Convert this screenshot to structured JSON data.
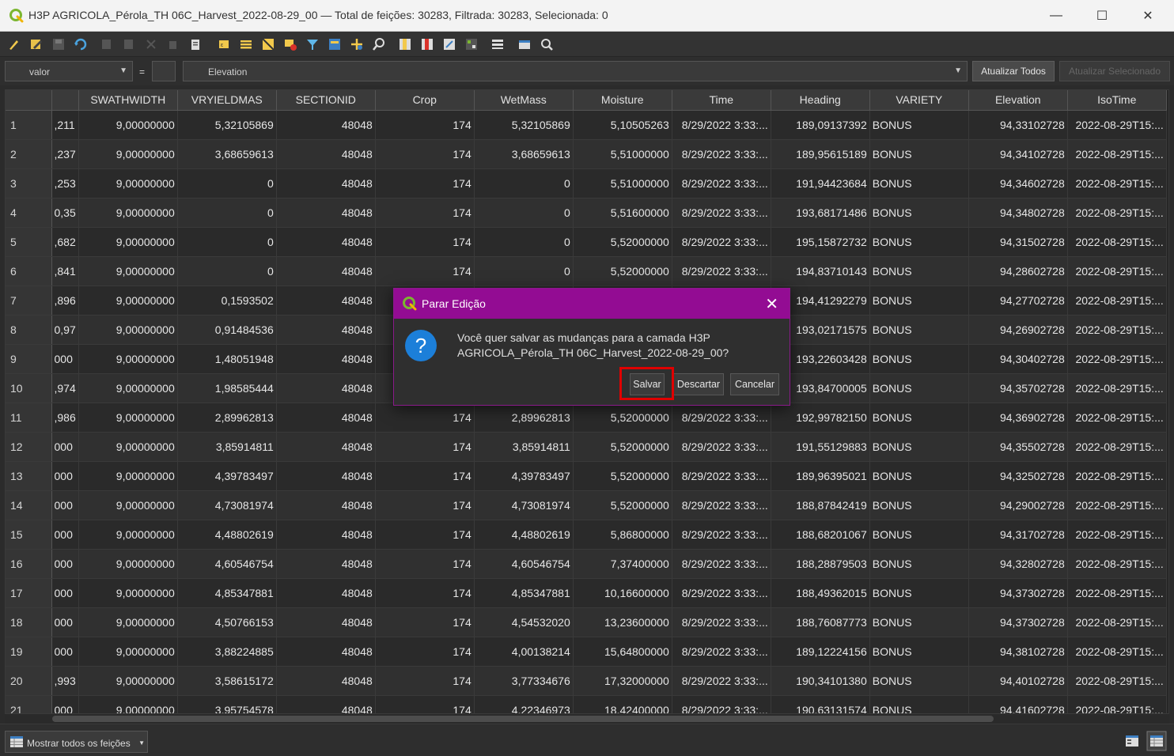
{
  "window": {
    "title": "H3P AGRICOLA_Pérola_TH 06C_Harvest_2022-08-29_00 — Total de feições: 30283, Filtrada: 30283, Selecionada: 0",
    "minimize": "—",
    "maximize": "☐",
    "close": "✕"
  },
  "toolbar": {
    "icons": [
      "toggle-edit-icon",
      "multi-edit-icon",
      "save-edits-icon",
      "reload-icon",
      "add-feature-icon",
      "delete-feature-icon",
      "cut-icon",
      "copy-icon",
      "paste-icon",
      "select-expression-icon",
      "select-all-icon",
      "invert-selection-icon",
      "deselect-icon",
      "filter-icon",
      "move-top-icon",
      "pan-to-selection-icon",
      "zoom-to-selection-icon",
      "new-field-icon",
      "delete-field-icon",
      "field-calculator-icon",
      "conditional-format-icon",
      "dock-icon",
      "actions-icon",
      "zoom-icon"
    ]
  },
  "filterbar": {
    "field": "valor",
    "equals": "=",
    "expression": "Elevation",
    "update_all": "Atualizar Todos",
    "update_selected": "Atualizar Selecionado"
  },
  "table": {
    "columns": [
      "",
      "SWATHWIDTH",
      "VRYIELDMAS",
      "SECTIONID",
      "Crop",
      "WetMass",
      "Moisture",
      "Time",
      "Heading",
      "VARIETY",
      "Elevation",
      "IsoTime"
    ],
    "rows": [
      [
        "1",
        ",211",
        "9,00000000",
        "5,32105869",
        "48048",
        "174",
        "5,32105869",
        "5,10505263",
        "8/29/2022 3:33:...",
        "189,09137392",
        "BONUS",
        "94,33102728",
        "2022-08-29T15:..."
      ],
      [
        "2",
        ",237",
        "9,00000000",
        "3,68659613",
        "48048",
        "174",
        "3,68659613",
        "5,51000000",
        "8/29/2022 3:33:...",
        "189,95615189",
        "BONUS",
        "94,34102728",
        "2022-08-29T15:..."
      ],
      [
        "3",
        ",253",
        "9,00000000",
        "0",
        "48048",
        "174",
        "0",
        "5,51000000",
        "8/29/2022 3:33:...",
        "191,94423684",
        "BONUS",
        "94,34602728",
        "2022-08-29T15:..."
      ],
      [
        "4",
        "0,35",
        "9,00000000",
        "0",
        "48048",
        "174",
        "0",
        "5,51600000",
        "8/29/2022 3:33:...",
        "193,68171486",
        "BONUS",
        "94,34802728",
        "2022-08-29T15:..."
      ],
      [
        "5",
        ",682",
        "9,00000000",
        "0",
        "48048",
        "174",
        "0",
        "5,52000000",
        "8/29/2022 3:33:...",
        "195,15872732",
        "BONUS",
        "94,31502728",
        "2022-08-29T15:..."
      ],
      [
        "6",
        ",841",
        "9,00000000",
        "0",
        "48048",
        "174",
        "0",
        "5,52000000",
        "8/29/2022 3:33:...",
        "194,83710143",
        "BONUS",
        "94,28602728",
        "2022-08-29T15:..."
      ],
      [
        "7",
        ",896",
        "9,00000000",
        "0,1593502",
        "48048",
        "",
        "",
        "",
        "",
        "194,41292279",
        "BONUS",
        "94,27702728",
        "2022-08-29T15:..."
      ],
      [
        "8",
        "0,97",
        "9,00000000",
        "0,91484536",
        "48048",
        "",
        "",
        "",
        "",
        "193,02171575",
        "BONUS",
        "94,26902728",
        "2022-08-29T15:..."
      ],
      [
        "9",
        "000",
        "9,00000000",
        "1,48051948",
        "48048",
        "",
        "",
        "",
        "",
        "193,22603428",
        "BONUS",
        "94,30402728",
        "2022-08-29T15:..."
      ],
      [
        "10",
        ",974",
        "9,00000000",
        "1,98585444",
        "48048",
        "",
        "",
        "",
        "",
        "193,84700005",
        "BONUS",
        "94,35702728",
        "2022-08-29T15:..."
      ],
      [
        "11",
        ",986",
        "9,00000000",
        "2,89962813",
        "48048",
        "174",
        "2,89962813",
        "5,52000000",
        "8/29/2022 3:33:...",
        "192,99782150",
        "BONUS",
        "94,36902728",
        "2022-08-29T15:..."
      ],
      [
        "12",
        "000",
        "9,00000000",
        "3,85914811",
        "48048",
        "174",
        "3,85914811",
        "5,52000000",
        "8/29/2022 3:33:...",
        "191,55129883",
        "BONUS",
        "94,35502728",
        "2022-08-29T15:..."
      ],
      [
        "13",
        "000",
        "9,00000000",
        "4,39783497",
        "48048",
        "174",
        "4,39783497",
        "5,52000000",
        "8/29/2022 3:33:...",
        "189,96395021",
        "BONUS",
        "94,32502728",
        "2022-08-29T15:..."
      ],
      [
        "14",
        "000",
        "9,00000000",
        "4,73081974",
        "48048",
        "174",
        "4,73081974",
        "5,52000000",
        "8/29/2022 3:33:...",
        "188,87842419",
        "BONUS",
        "94,29002728",
        "2022-08-29T15:..."
      ],
      [
        "15",
        "000",
        "9,00000000",
        "4,48802619",
        "48048",
        "174",
        "4,48802619",
        "5,86800000",
        "8/29/2022 3:33:...",
        "188,68201067",
        "BONUS",
        "94,31702728",
        "2022-08-29T15:..."
      ],
      [
        "16",
        "000",
        "9,00000000",
        "4,60546754",
        "48048",
        "174",
        "4,60546754",
        "7,37400000",
        "8/29/2022 3:33:...",
        "188,28879503",
        "BONUS",
        "94,32802728",
        "2022-08-29T15:..."
      ],
      [
        "17",
        "000",
        "9,00000000",
        "4,85347881",
        "48048",
        "174",
        "4,85347881",
        "10,16600000",
        "8/29/2022 3:33:...",
        "188,49362015",
        "BONUS",
        "94,37302728",
        "2022-08-29T15:..."
      ],
      [
        "18",
        "000",
        "9,00000000",
        "4,50766153",
        "48048",
        "174",
        "4,54532020",
        "13,23600000",
        "8/29/2022 3:33:...",
        "188,76087773",
        "BONUS",
        "94,37302728",
        "2022-08-29T15:..."
      ],
      [
        "19",
        "000",
        "9,00000000",
        "3,88224885",
        "48048",
        "174",
        "4,00138214",
        "15,64800000",
        "8/29/2022 3:33:...",
        "189,12224156",
        "BONUS",
        "94,38102728",
        "2022-08-29T15:..."
      ],
      [
        "20",
        ",993",
        "9,00000000",
        "3,58615172",
        "48048",
        "174",
        "3,77334676",
        "17,32000000",
        "8/29/2022 3:33:...",
        "190,34101380",
        "BONUS",
        "94,40102728",
        "2022-08-29T15:..."
      ],
      [
        "21",
        "000",
        "9,00000000",
        "3,95754578",
        "48048",
        "174",
        "4,22346973",
        "18,42400000",
        "8/29/2022 3:33:...",
        "190,63131574",
        "BONUS",
        "94,41602728",
        "2022-08-29T15:..."
      ]
    ]
  },
  "statusbar": {
    "show_all": "Mostrar todos os feições"
  },
  "dialog": {
    "title": "Parar Edição",
    "close": "✕",
    "icon": "?",
    "message_line1": "Você quer salvar as mudanças para a camada H3P",
    "message_line2": "AGRICOLA_Pérola_TH 06C_Harvest_2022-08-29_00?",
    "save": "Salvar",
    "discard": "Descartar",
    "cancel": "Cancelar"
  }
}
